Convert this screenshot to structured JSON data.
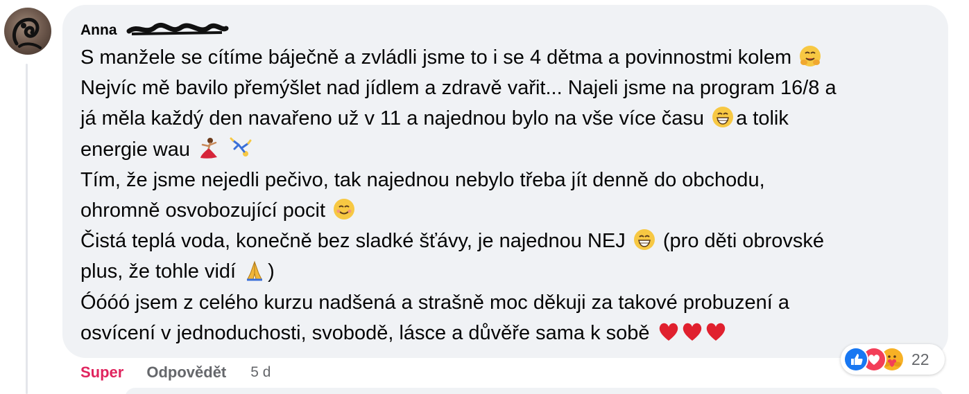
{
  "comment": {
    "author": "Anna",
    "lines": [
      "S manžele se cítíme báječně a zvládli jsme to i se 4 dětma a povinnostmi kolem",
      "Nejvíc mě bavilo přemýšlet nad jídlem a zdravě vařit... Najeli jsme na program 16/8 a",
      "já měla každý den navařeno už v 11 a najednou bylo na vše více času",
      "a tolik",
      "energie wau",
      "Tím, že jsme nejedli pečivo, tak najednou nebylo třeba jít denně do obchodu,",
      "ohromně osvobozující pocit",
      "Čistá teplá voda, konečně bez sladké šťávy, je najednou NEJ",
      "(pro děti obrovské",
      "plus, že tohle vidí",
      ")",
      "Óóóó jsem z celého kurzu nadšená a strašně moc děkuji za takové probuzení a",
      "osvícení v jednoduchosti, svobodě, lásce a důvěře sama k sobě"
    ],
    "emojis": [
      "hugging-face",
      "grinning-face",
      "dancer",
      "cartwheel",
      "smiling-face",
      "grinning-face",
      "folded-hands",
      "red-heart"
    ]
  },
  "actions": {
    "like_label": "Super",
    "reply_label": "Odpovědět",
    "time": "5 d"
  },
  "reactions": {
    "types": [
      "like",
      "love",
      "care"
    ],
    "count": "22"
  },
  "colors": {
    "bubble": "#f0f2f5",
    "super": "#e0245e",
    "muted": "#65676b",
    "like_blue": "#1877f2",
    "love_red": "#f33e58",
    "care_yellow": "#f7b125"
  }
}
